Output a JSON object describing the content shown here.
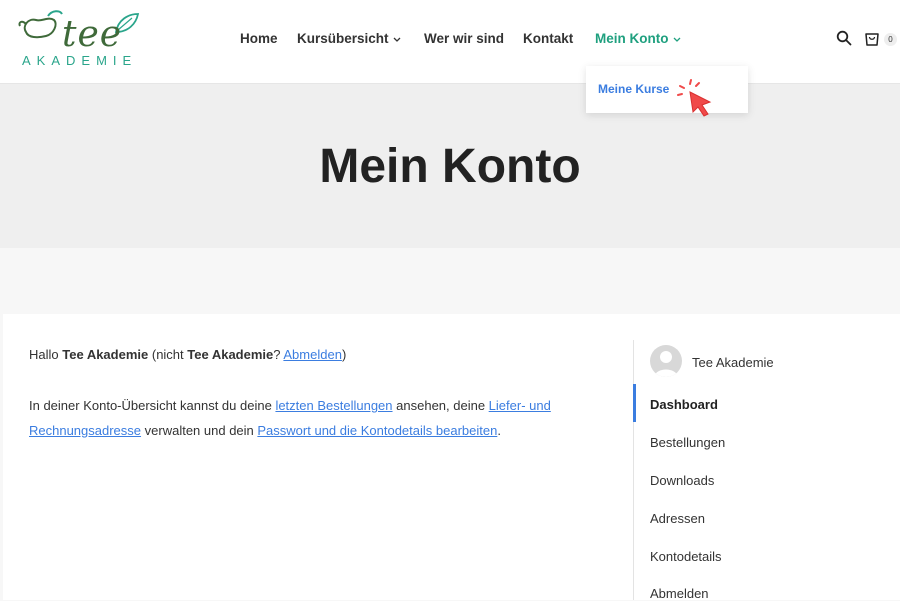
{
  "header": {
    "logo": {
      "word": "tee",
      "sub": "AKADEMIE"
    },
    "nav": [
      {
        "label": "Home"
      },
      {
        "label": "Kursübersicht"
      },
      {
        "label": "Wer wir sind"
      },
      {
        "label": "Kontakt"
      },
      {
        "label": "Mein Konto"
      }
    ],
    "cart_count": "0"
  },
  "dropdown": {
    "item": "Meine Kurse"
  },
  "hero": {
    "title": "Mein Konto"
  },
  "account": {
    "greeting": {
      "prefix": "Hallo ",
      "name": "Tee Akademie",
      "mid": " (nicht ",
      "name2": "Tee Akademie",
      "q": "? ",
      "logout_link": "Abmelden",
      "close": ")"
    },
    "overview": {
      "t1": "In deiner Konto-Übersicht kannst du deine ",
      "link_orders": "letzten Bestellungen",
      "t2": " ansehen, deine ",
      "link_addresses": "Liefer- und Rechnungsadresse",
      "t3": " verwalten und dein ",
      "link_password": "Passwort und die Kontodetails bearbeiten",
      "t4": "."
    }
  },
  "sidebar": {
    "user": "Tee Akademie",
    "items": [
      {
        "label": "Dashboard"
      },
      {
        "label": "Bestellungen"
      },
      {
        "label": "Downloads"
      },
      {
        "label": "Adressen"
      },
      {
        "label": "Kontodetails"
      },
      {
        "label": "Abmelden"
      }
    ]
  },
  "colors": {
    "accent": "#1fa07f",
    "link": "#3b7de0",
    "pointer": "#f04a4a"
  },
  "icons": {
    "search": "search-icon",
    "cart": "cart-icon",
    "pointer": "cursor-click-icon"
  }
}
